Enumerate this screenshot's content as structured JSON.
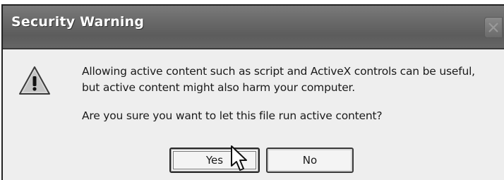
{
  "dialog": {
    "title": "Security Warning",
    "message_line1": "Allowing active content such as script and ActiveX controls can be useful,",
    "message_line2": "but active content might also harm your computer.",
    "question": "Are you sure you want to let this file run active content?",
    "icon": "warning-icon",
    "buttons": {
      "yes_label": "Yes",
      "no_label": "No"
    }
  },
  "cursor": "arrow-pointer-icon"
}
